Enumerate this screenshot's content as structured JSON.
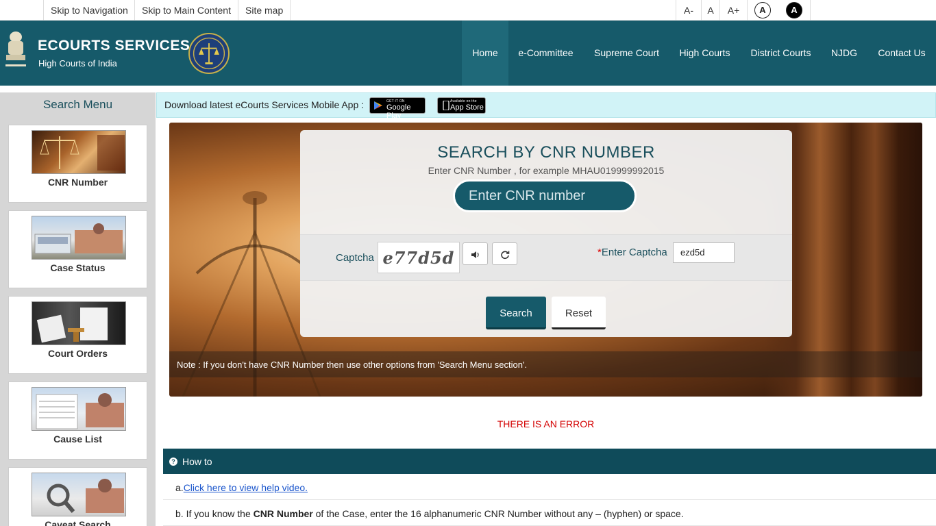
{
  "topbar": {
    "skip_nav": "Skip to Navigation",
    "skip_main": "Skip to Main Content",
    "sitemap": "Site map",
    "font_decrease": "A-",
    "font_normal": "A",
    "font_increase": "A+",
    "contrast_normal": "A",
    "contrast_high": "A"
  },
  "header": {
    "title": "ECOURTS SERVICES",
    "subtitle": "High Courts of India",
    "nav": [
      "Home",
      "e-Committee",
      "Supreme Court",
      "High Courts",
      "District Courts",
      "NJDG",
      "Contact Us"
    ],
    "active_nav": "Home",
    "brand_color": "#165a6a"
  },
  "sidebar": {
    "title": "Search Menu",
    "items": [
      {
        "label": "CNR Number",
        "icon": "scales-of-justice-icon"
      },
      {
        "label": "Case Status",
        "icon": "court-building-icon"
      },
      {
        "label": "Court Orders",
        "icon": "court-order-document-icon"
      },
      {
        "label": "Cause List",
        "icon": "cause-list-document-icon"
      },
      {
        "label": "Caveat Search",
        "icon": "magnifier-icon"
      }
    ]
  },
  "appbanner": {
    "text": "Download latest eCourts Services Mobile App :",
    "google_small": "GET IT ON",
    "google_big": "Google Play",
    "apple_small": "Available on the",
    "apple_big": "App Store"
  },
  "search": {
    "title": "SEARCH BY CNR NUMBER",
    "hint": "Enter CNR Number , for example MHAU019999992015",
    "cnr_placeholder": "Enter CNR number",
    "cnr_value": "",
    "captcha_label": "Captcha",
    "captcha_text": "e77d5d",
    "audio_icon": "speaker-icon",
    "refresh_icon": "refresh-icon",
    "enter_captcha_required": "*",
    "enter_captcha_label": "Enter Captcha",
    "captcha_value": "ezd5d",
    "search_button": "Search",
    "reset_button": "Reset",
    "note": "Note : If you don't have CNR Number then use other options from 'Search Menu section'."
  },
  "error": {
    "message": "THERE IS AN ERROR",
    "color": "#d40000"
  },
  "howto": {
    "title": "How to",
    "a_prefix": "a.",
    "a_link": "Click here to view help video.",
    "b_prefix": "b. If you know the ",
    "b_bold": "CNR Number",
    "b_suffix": " of the Case, enter the 16 alphanumeric CNR Number without any – (hyphen) or space."
  }
}
